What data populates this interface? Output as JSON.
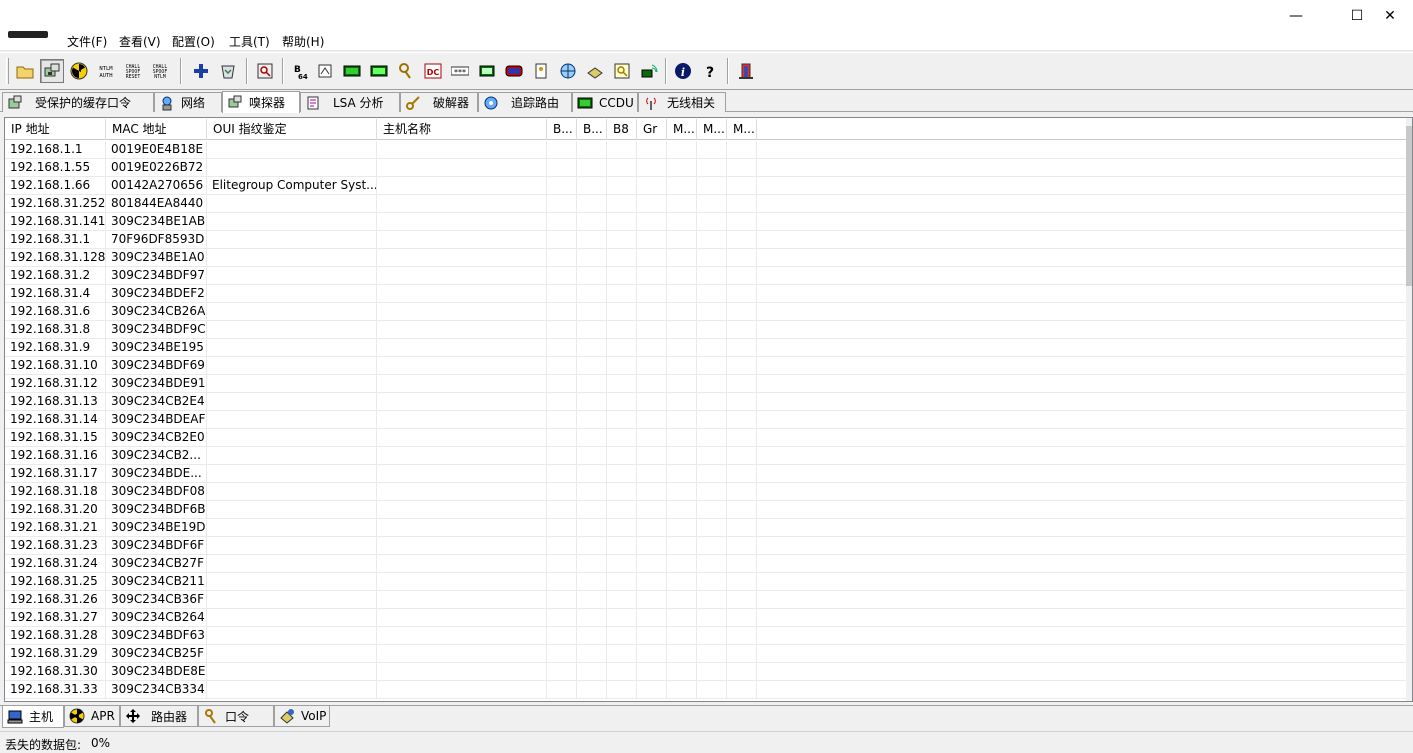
{
  "window": {
    "minimize": "—",
    "maximize": "☐",
    "close": "✕"
  },
  "menu": [
    "文件(F)",
    "查看(V)",
    "配置(O)",
    "工具(T)",
    "帮助(H)"
  ],
  "toolbar": {
    "icons": [
      "folder-icon",
      "sniffer-network-icon",
      "radiation-icon",
      "ntlm-auth-icon",
      "chall-spoof-reset-icon",
      "chall-spoof-ntlm-icon",
      "add-icon",
      "recycle-icon",
      "scan-icon",
      "base64-icon",
      "route-icon",
      "hash-calc-icon",
      "vpn-icon",
      "key-icon",
      "dc-icon",
      "password-icon",
      "terminal-icon",
      "router-icon",
      "certificate-icon",
      "network-globe-icon",
      "disk-icon",
      "key-lock-icon",
      "wireless-icon",
      "info-icon",
      "help-icon",
      "exit-icon"
    ],
    "labels": {
      "ntlm": [
        "NTLM",
        "AUTH"
      ],
      "chall1": [
        "CHALL",
        "SPOOF",
        "RESET"
      ],
      "chall2": [
        "CHALL",
        "SPOOF",
        "NTLM"
      ],
      "b64": [
        "B",
        "64"
      ],
      "dc": "DC",
      "pw": "***"
    }
  },
  "top_tabs": [
    {
      "label": "受保护的缓存口令",
      "icon": "cache-icon"
    },
    {
      "label": "网络",
      "icon": "network-icon"
    },
    {
      "label": "嗅探器",
      "icon": "sniffer-icon"
    },
    {
      "label": "LSA 分析",
      "icon": "lsa-icon"
    },
    {
      "label": "破解器",
      "icon": "cracker-icon"
    },
    {
      "label": "追踪路由",
      "icon": "traceroute-icon"
    },
    {
      "label": "CCDU",
      "icon": "ccdu-icon"
    },
    {
      "label": "无线相关",
      "icon": "wireless-icon"
    }
  ],
  "table": {
    "columns": [
      "IP 地址",
      "MAC 地址",
      "OUI 指纹鉴定",
      "主机名称",
      "B...",
      "B...",
      "B8",
      "Gr",
      "M...",
      "M...",
      "M..."
    ],
    "rows": [
      [
        "192.168.1.1",
        "0019E0E4B18E",
        ""
      ],
      [
        "192.168.1.55",
        "0019E0226B72",
        ""
      ],
      [
        "192.168.1.66",
        "00142A270656",
        "Elitegroup Computer Syst..."
      ],
      [
        "192.168.31.252",
        "801844EA8440",
        ""
      ],
      [
        "192.168.31.141",
        "309C234BE1AB",
        ""
      ],
      [
        "192.168.31.1",
        "70F96DF8593D",
        ""
      ],
      [
        "192.168.31.128",
        "309C234BE1A0",
        ""
      ],
      [
        "192.168.31.2",
        "309C234BDF97",
        ""
      ],
      [
        "192.168.31.4",
        "309C234BDEF2",
        ""
      ],
      [
        "192.168.31.6",
        "309C234CB26A",
        ""
      ],
      [
        "192.168.31.8",
        "309C234BDF9C",
        ""
      ],
      [
        "192.168.31.9",
        "309C234BE195",
        ""
      ],
      [
        "192.168.31.10",
        "309C234BDF69",
        ""
      ],
      [
        "192.168.31.12",
        "309C234BDE91",
        ""
      ],
      [
        "192.168.31.13",
        "309C234CB2E4",
        ""
      ],
      [
        "192.168.31.14",
        "309C234BDEAF",
        ""
      ],
      [
        "192.168.31.15",
        "309C234CB2E0",
        ""
      ],
      [
        "192.168.31.16",
        "309C234CB2...",
        ""
      ],
      [
        "192.168.31.17",
        "309C234BDE...",
        ""
      ],
      [
        "192.168.31.18",
        "309C234BDF08",
        ""
      ],
      [
        "192.168.31.20",
        "309C234BDF6B",
        ""
      ],
      [
        "192.168.31.21",
        "309C234BE19D",
        ""
      ],
      [
        "192.168.31.23",
        "309C234BDF6F",
        ""
      ],
      [
        "192.168.31.24",
        "309C234CB27F",
        ""
      ],
      [
        "192.168.31.25",
        "309C234CB211",
        ""
      ],
      [
        "192.168.31.26",
        "309C234CB36F",
        ""
      ],
      [
        "192.168.31.27",
        "309C234CB264",
        ""
      ],
      [
        "192.168.31.28",
        "309C234BDF63",
        ""
      ],
      [
        "192.168.31.29",
        "309C234CB25F",
        ""
      ],
      [
        "192.168.31.30",
        "309C234BDE8E",
        ""
      ],
      [
        "192.168.31.33",
        "309C234CB334",
        ""
      ]
    ]
  },
  "bottom_tabs": [
    {
      "label": "主机",
      "icon": "host-icon"
    },
    {
      "label": "APR",
      "icon": "apr-icon"
    },
    {
      "label": "路由器",
      "icon": "router-move-icon"
    },
    {
      "label": "口令",
      "icon": "password-key-icon"
    },
    {
      "label": "VoIP",
      "icon": "voip-icon"
    }
  ],
  "status": {
    "label": "丢失的数据包:",
    "value": "0%"
  }
}
